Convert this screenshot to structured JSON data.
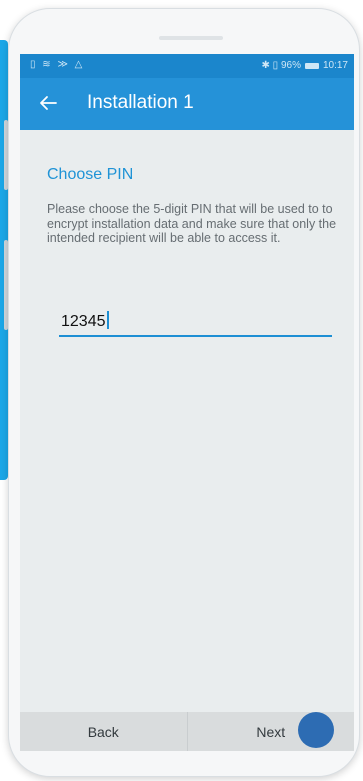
{
  "status_bar": {
    "left_icons": "▯ ≋ ≫ △",
    "right_text": "✱ ▯ 96%",
    "time": "10:17"
  },
  "toolbar": {
    "back_icon": "arrow-left",
    "title": "Installation 1"
  },
  "content": {
    "section_title": "Choose PIN",
    "description": "Please choose the 5-digit PIN that will be used to to encrypt installation data and make sure that only the intended recipient will be able to access it.",
    "pin_value": "12345"
  },
  "footer": {
    "back_label": "Back",
    "next_label": "Next"
  },
  "colors": {
    "status_bar": "#1b86cc",
    "toolbar": "#2592d8",
    "accent": "#1f93d6",
    "fab": "#2d6cb3"
  }
}
